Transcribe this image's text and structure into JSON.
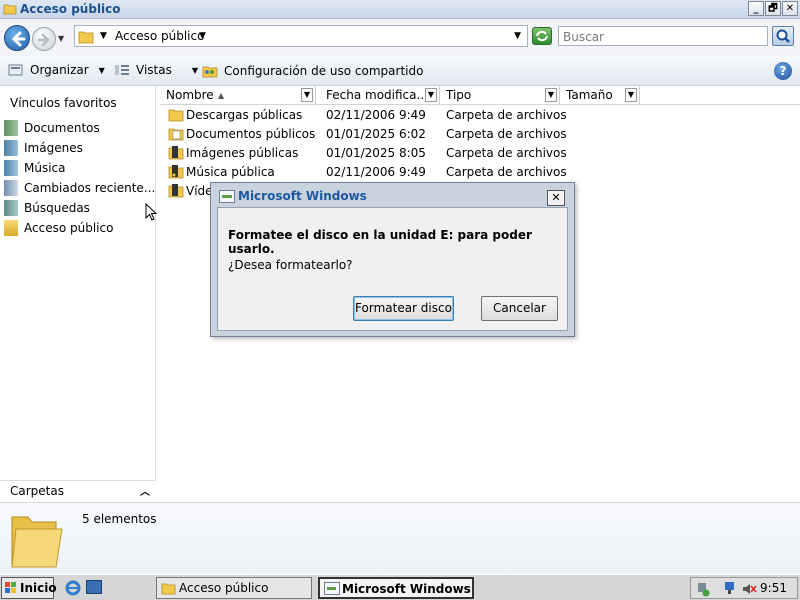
{
  "window": {
    "title": "Acceso público",
    "controls": [
      "_",
      "🗗",
      "✕"
    ]
  },
  "address": {
    "path": "Acceso público",
    "search_placeholder": "Buscar"
  },
  "toolbar": {
    "organize_label": "Organizar",
    "views_label": "Vistas",
    "sharing_label": "Configuración de uso compartido"
  },
  "sidebar": {
    "favorites_header": "Vínculos favoritos",
    "items": [
      {
        "label": "Documentos",
        "icon": "documents-icon"
      },
      {
        "label": "Imágenes",
        "icon": "pictures-icon"
      },
      {
        "label": "Música",
        "icon": "music-icon"
      },
      {
        "label": "Cambiados reciente...",
        "icon": "recent-icon"
      },
      {
        "label": "Búsquedas",
        "icon": "searches-icon"
      },
      {
        "label": "Acceso público",
        "icon": "folder-icon"
      }
    ],
    "folders_label": "Carpetas"
  },
  "filelist": {
    "columns": [
      "Nombre",
      "Fecha modifica...",
      "Tipo",
      "Tamaño"
    ],
    "rows": [
      {
        "name": "Descargas públicas",
        "date": "02/11/2006 9:49",
        "type": "Carpeta de archivos"
      },
      {
        "name": "Documentos públicos",
        "date": "01/01/2025 6:02",
        "type": "Carpeta de archivos"
      },
      {
        "name": "Imágenes públicas",
        "date": "01/01/2025 8:05",
        "type": "Carpeta de archivos"
      },
      {
        "name": "Música pública",
        "date": "02/11/2006 9:49",
        "type": "Carpeta de archivos"
      },
      {
        "name": "Víde",
        "date": "",
        "type": ""
      }
    ]
  },
  "details": {
    "count_text": "5 elementos"
  },
  "dialog": {
    "title": "Microsoft Windows",
    "message": "Formatee el disco en la unidad E: para poder usarlo.",
    "question": "¿Desea formatearlo?",
    "format_button": "Formatear disco",
    "cancel_button": "Cancelar",
    "close_glyph": "✕"
  },
  "taskbar": {
    "start_label": "Inicio",
    "tasks": [
      {
        "label": "Acceso público"
      },
      {
        "label": "Microsoft Windows"
      }
    ],
    "clock": "9:51"
  },
  "colors": {
    "title_text": "#1f4f8f",
    "dialog_title_text": "#1f58a0",
    "folder_yellow": "#f2c94c"
  }
}
